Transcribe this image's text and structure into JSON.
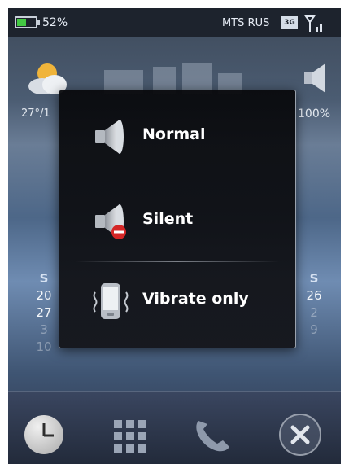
{
  "status_bar": {
    "battery_percent": "52%",
    "battery_level": 0.52,
    "carrier": "MTS RUS",
    "network_type": "3G"
  },
  "home": {
    "temperature": "27°/1",
    "volume": "100%"
  },
  "calendar": {
    "left_column": {
      "header": "S",
      "dates": [
        "20",
        "27",
        "3",
        "10"
      ]
    },
    "right_column": {
      "header": "S",
      "dates": [
        "26",
        "2",
        "9"
      ]
    }
  },
  "dialog": {
    "options": [
      {
        "label": "Normal",
        "icon": "speaker-icon"
      },
      {
        "label": "Silent",
        "icon": "muted-speaker-icon"
      },
      {
        "label": "Vibrate only",
        "icon": "vibrating-phone-icon"
      }
    ]
  },
  "taskbar": {
    "icons": [
      "clock-icon",
      "app-grid-icon",
      "phone-icon",
      "close-icon"
    ]
  },
  "colors": {
    "battery_fill": "#43c943",
    "dialog_bg": "#0c0d11",
    "silent_badge": "#d42626"
  }
}
